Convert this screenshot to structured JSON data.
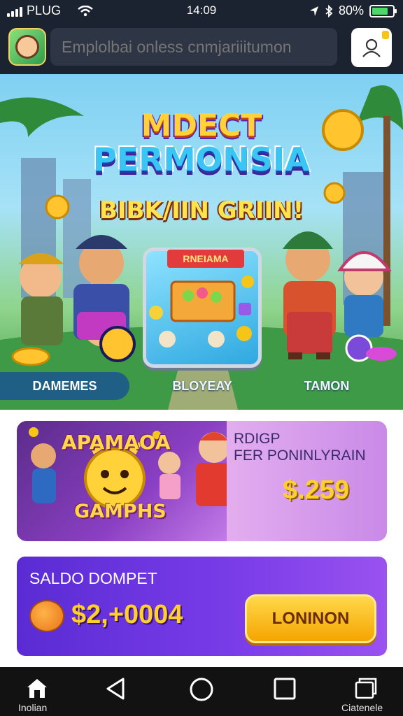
{
  "status_bar": {
    "carrier": "PLUG",
    "time": "14:09",
    "battery": "80%",
    "battery_level": 0.8
  },
  "header": {
    "search_placeholder": "Emplolbai onless cnmjariiitumon"
  },
  "hero": {
    "title_line1": "MDECT",
    "title_line2": "PERMONSIA",
    "title_line3": "BIBK/IIN GRIIN!",
    "card_banner": "RNEIAMA",
    "pill_left": "DAMEMES",
    "pill_mid": "BLOYEAY",
    "pill_right": "TAMON"
  },
  "promo": {
    "art_title": "APAMAOA",
    "art_subtitle": "GAMPHS",
    "line1": "RDIGP",
    "line2": "FER PONINLYRAIN",
    "amount": "$.259"
  },
  "wallet": {
    "label": "SALDO DOMPET",
    "amount": "$2,+0004",
    "button_label": "LONINON"
  },
  "bottom_nav": {
    "home_label": "Inolian",
    "right_label": "Ciatenele"
  },
  "colors": {
    "topbar": "#1c2330",
    "wallet_gradient_start": "#5a2bd4",
    "button_yellow": "#ffd84a",
    "nav_bg": "#121212"
  }
}
